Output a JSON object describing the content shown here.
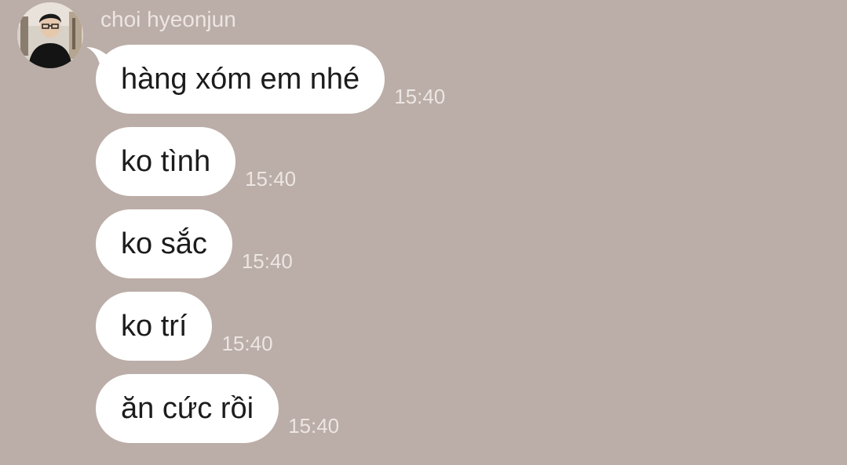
{
  "chat": {
    "sender_name": "choi hyeonjun",
    "messages": [
      {
        "text": "hàng xóm em nhé",
        "time": "15:40"
      },
      {
        "text": "ko tình",
        "time": "15:40"
      },
      {
        "text": "ko sắc",
        "time": "15:40"
      },
      {
        "text": "ko trí",
        "time": "15:40"
      },
      {
        "text": "ăn cức rồi",
        "time": "15:40"
      }
    ]
  },
  "colors": {
    "background": "#bbada7",
    "bubble": "#ffffff",
    "meta_text": "#ece6e3"
  }
}
